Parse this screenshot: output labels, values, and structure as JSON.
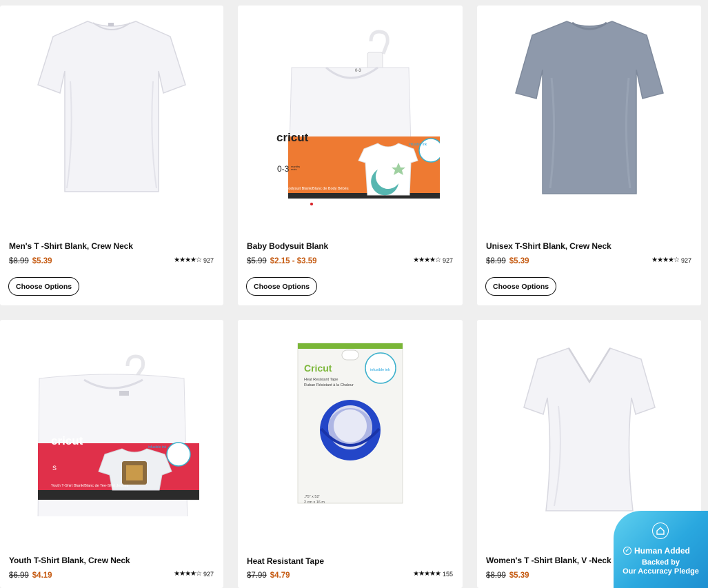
{
  "products": [
    {
      "name": "Men's T -Shirt Blank, Crew Neck",
      "old_price": "$8.99",
      "new_price": "$5.39",
      "rating_count": "927",
      "button": "Choose Options"
    },
    {
      "name": "Baby Bodysuit Blank",
      "old_price": "$5.99",
      "new_price": "$2.15 - $3.59",
      "rating_count": "927",
      "button": "Choose Options",
      "package": {
        "brand": "cricut",
        "size": "0-3",
        "size_sub": "months mois",
        "caption": "Baby Bodysuit Blank/Blanc de Body Bébés",
        "seal": "infusible ink",
        "hanger_tag": "0-3"
      }
    },
    {
      "name": "Unisex T-Shirt Blank, Crew Neck",
      "old_price": "$8.99",
      "new_price": "$5.39",
      "rating_count": "927",
      "button": "Choose Options"
    },
    {
      "name": "Youth T-Shirt Blank, Crew Neck",
      "old_price": "$6.99",
      "new_price": "$4.19",
      "rating_count": "927",
      "package": {
        "brand": "cricut",
        "size": "S",
        "caption": "Youth T-Shirt Blank/Blanc de Tee-Shirt Jeunes",
        "seal": "infusible ink"
      }
    },
    {
      "name": "Heat Resistant Tape",
      "old_price": "$7.99",
      "new_price": "$4.79",
      "rating_count": "155",
      "package": {
        "brand": "Cricut",
        "line1": "Heat Resistant Tape",
        "line2": "Ruban Résistant à la Chaleur",
        "dims1": ".75\" x 52'",
        "dims2": "2 cm x 16 m",
        "seal": "infusible ink"
      }
    },
    {
      "name": "Women's T -Shirt Blank, V -Neck",
      "old_price": "$8.99",
      "new_price": "$5.39"
    }
  ],
  "badge": {
    "title": "Human Added",
    "line1": "Backed by",
    "line2": "Our Accuracy Pledge"
  },
  "colors": {
    "accent_price": "#c55a11",
    "cricut_orange": "#ee7a32",
    "cricut_red": "#e0304a",
    "tape_blue": "#2346c8",
    "badge": "#2aa8df"
  }
}
